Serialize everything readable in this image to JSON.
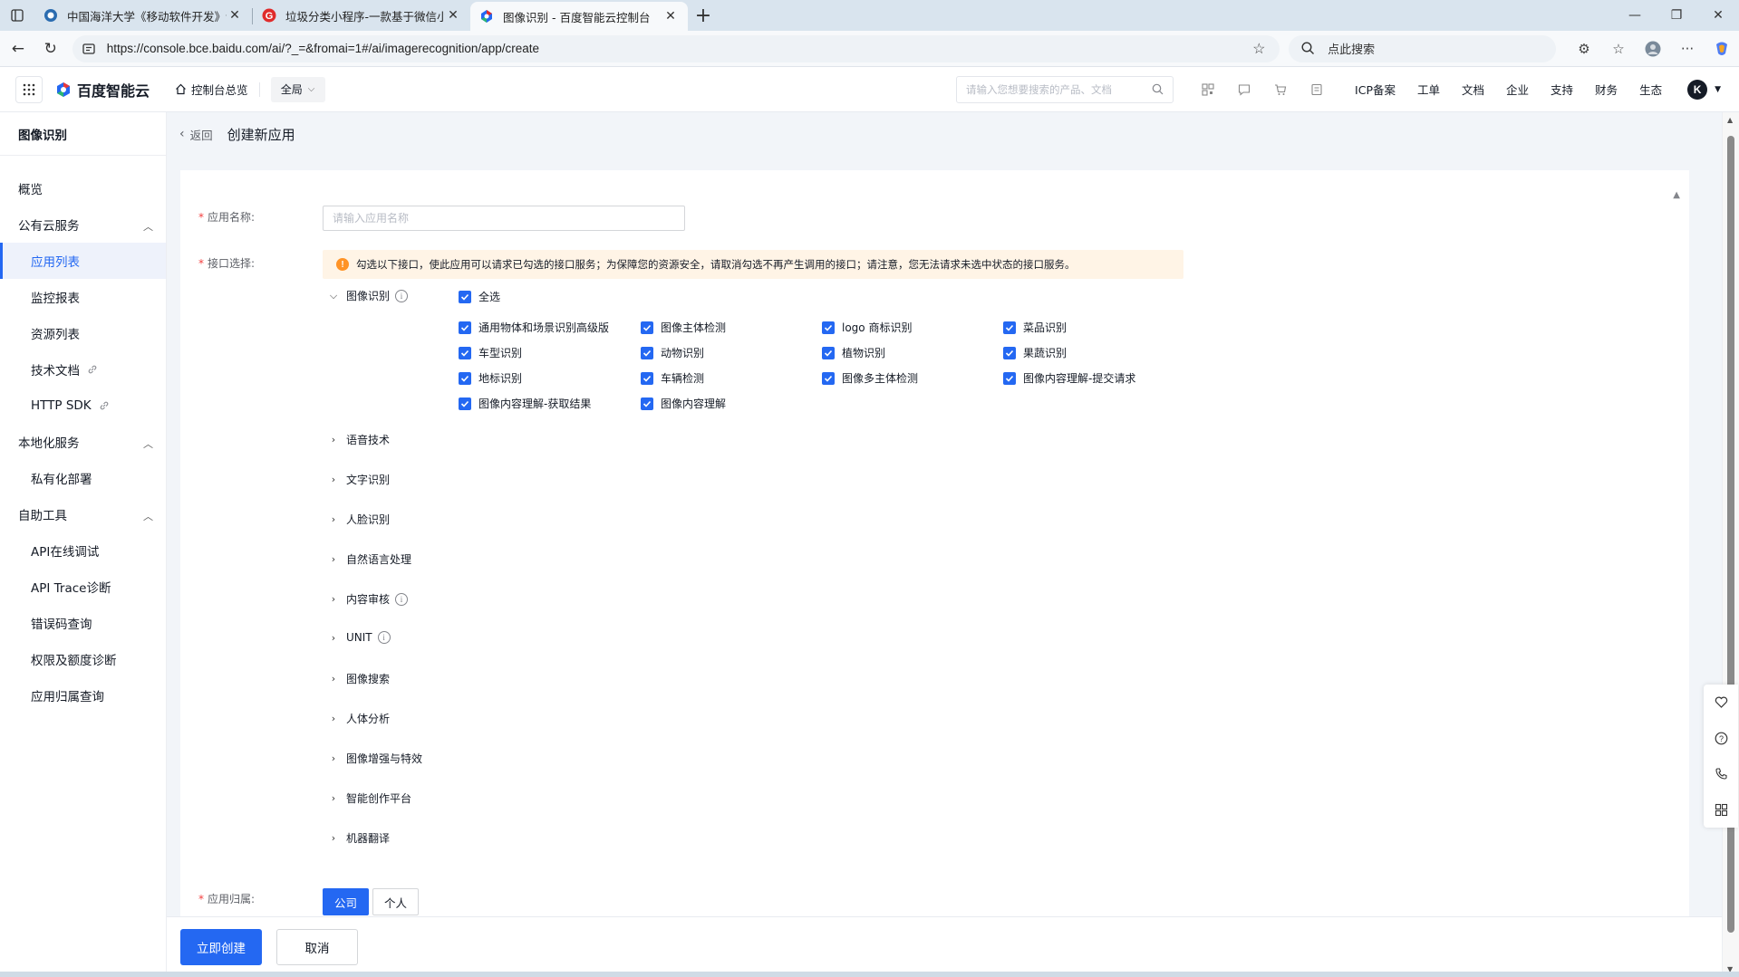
{
  "browser": {
    "tabs": [
      {
        "title": "中国海洋大学《移动软件开发》课",
        "active": false
      },
      {
        "title": "垃圾分类小程序-一款基于微信小",
        "active": false
      },
      {
        "title": "图像识别 - 百度智能云控制台",
        "active": true
      }
    ],
    "new_tab": "+",
    "url": "https://console.bce.baidu.com/ai/?_=&fromai=1#/ai/imagerecognition/app/create",
    "search_placeholder": "点此搜索",
    "win": {
      "min": "—",
      "restore": "❐",
      "close": "✕"
    }
  },
  "topnav": {
    "brand": "百度智能云",
    "home": "控制台总览",
    "region": "全局",
    "search_placeholder": "请输入您想要搜索的产品、文档",
    "links": [
      "ICP备案",
      "工单",
      "文档",
      "企业",
      "支持",
      "财务",
      "生态"
    ],
    "avatar_letter": "K"
  },
  "sidebar": {
    "title": "图像识别",
    "items": [
      {
        "label": "概览"
      },
      {
        "label": "公有云服务"
      },
      {
        "label": "应用列表"
      },
      {
        "label": "监控报表"
      },
      {
        "label": "资源列表"
      },
      {
        "label": "技术文档"
      },
      {
        "label": "HTTP SDK"
      },
      {
        "label": "本地化服务"
      },
      {
        "label": "私有化部署"
      },
      {
        "label": "自助工具"
      },
      {
        "label": "API在线调试"
      },
      {
        "label": "API Trace诊断"
      },
      {
        "label": "错误码查询"
      },
      {
        "label": "权限及额度诊断"
      },
      {
        "label": "应用归属查询"
      }
    ]
  },
  "page": {
    "back": "返回",
    "title": "创建新应用"
  },
  "form": {
    "name_label": "应用名称:",
    "name_placeholder": "请输入应用名称",
    "api_label": "接口选择:",
    "notice": "勾选以下接口，使此应用可以请求已勾选的接口服务；为保障您的资源安全，请取消勾选不再产生调用的接口；请注意，您无法请求未选中状态的接口服务。",
    "expanded_group": "图像识别",
    "select_all": "全选",
    "checkboxes": [
      "通用物体和场景识别高级版",
      "图像主体检测",
      "logo 商标识别",
      "菜品识别",
      "车型识别",
      "动物识别",
      "植物识别",
      "果蔬识别",
      "地标识别",
      "车辆检测",
      "图像多主体检测",
      "图像内容理解-提交请求",
      "图像内容理解-获取结果",
      "图像内容理解"
    ],
    "collapsed_groups": [
      "语音技术",
      "文字识别",
      "人脸识别",
      "自然语言处理",
      "内容审核",
      "UNIT",
      "图像搜索",
      "人体分析",
      "图像增强与特效",
      "智能创作平台",
      "机器翻译"
    ],
    "owner_label": "应用归属:",
    "owner_options": [
      "公司",
      "个人"
    ],
    "owner_selected": "公司"
  },
  "footer": {
    "create": "立即创建",
    "cancel": "取消"
  }
}
